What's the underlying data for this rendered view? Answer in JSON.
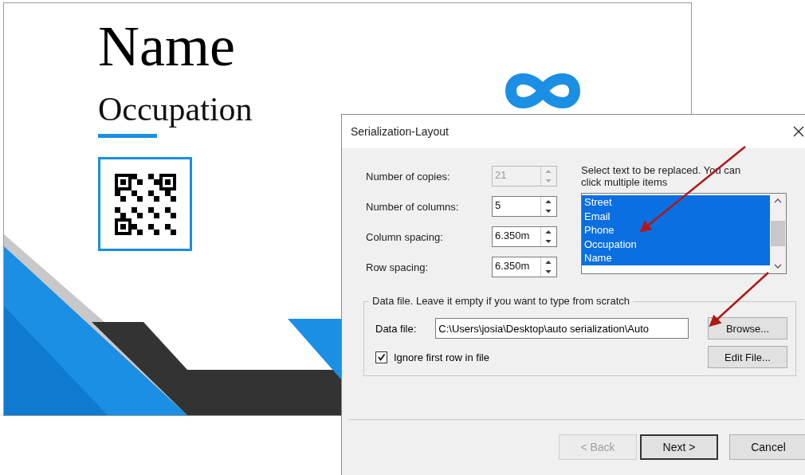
{
  "card": {
    "name": "Name",
    "occupation": "Occupation"
  },
  "dialog": {
    "title": "Serialization-Layout",
    "fields": [
      {
        "label": "Number of copies:",
        "value": "21",
        "disabled": true
      },
      {
        "label": "Number of columns:",
        "value": "5",
        "disabled": false
      },
      {
        "label": "Column spacing:",
        "value": "6.350m",
        "disabled": false
      },
      {
        "label": "Row spacing:",
        "value": "6.350m",
        "disabled": false
      }
    ],
    "list": {
      "label": "Select text to be replaced. You can click multiple items",
      "items": [
        {
          "label": "Street",
          "selected": true
        },
        {
          "label": "Email",
          "selected": true
        },
        {
          "label": "Phone",
          "selected": true
        },
        {
          "label": "Occupation",
          "selected": true
        },
        {
          "label": "Name",
          "selected": true
        }
      ]
    },
    "group": {
      "legend": "Data file. Leave it empty if you want to type from scratch",
      "file_label": "Data file:",
      "file_value": "C:\\Users\\josia\\Desktop\\auto serialization\\Auto",
      "browse": "Browse...",
      "edit": "Edit File...",
      "ignore_first_row": {
        "label": "Ignore first row in file",
        "checked": true
      }
    },
    "buttons": [
      {
        "label": "< Back",
        "disabled": true,
        "default": false
      },
      {
        "label": "Next >",
        "disabled": false,
        "default": true
      },
      {
        "label": "Cancel",
        "disabled": false,
        "default": false
      }
    ]
  }
}
